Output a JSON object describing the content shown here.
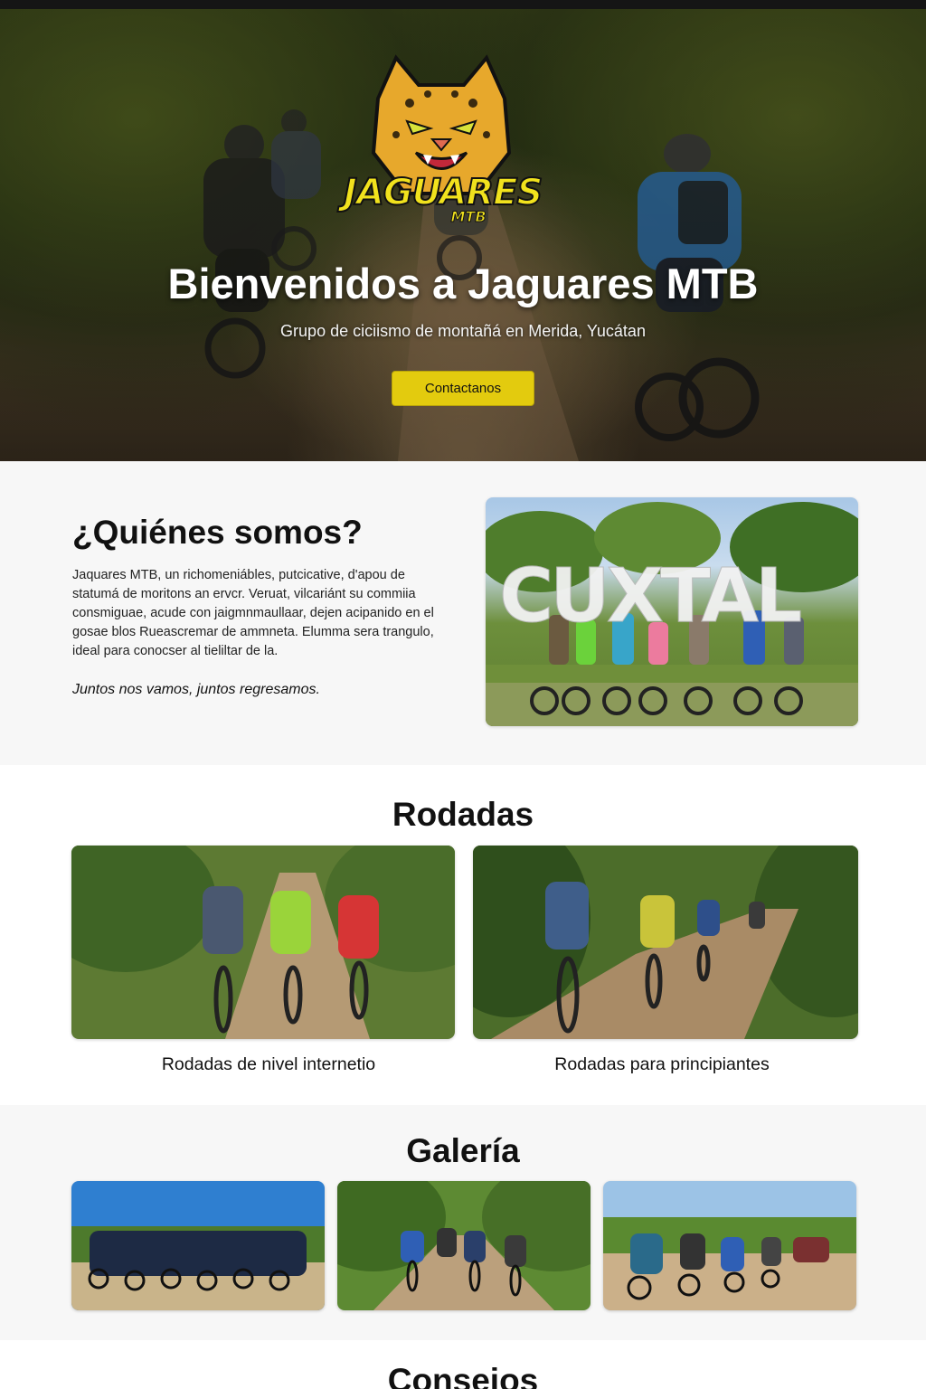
{
  "hero": {
    "logo": {
      "main_text": "JAGUARES",
      "sub_text": "MTB"
    },
    "title": "Bienvenidos a Jaguares MTB",
    "subtitle": "Grupo de ciciismo de montañá en Merida, Yucátan",
    "cta_label": "Contactanos",
    "accent_color": "#e3cb0e"
  },
  "about": {
    "title": "¿Quiénes somos?",
    "paragraph": "Jaquares MTB, un richomeniábles, putcicative, d'apou de statumá de moritons an ervcr. Veruat, vilcariánt su commiia consmiguae, acude con jaigmnmaullaar, dejen acipanido en el gosae blos Rueascremar de ammneta. Elumma sera trangulo, ideal para conocser al tieliltar de la.",
    "quote": "Juntos nos vamos, juntos regresamos.",
    "photo_sign_text": "CUXTAL"
  },
  "rodadas": {
    "title": "Rodadas",
    "cards": [
      {
        "caption": "Rodadas de nivel internetio"
      },
      {
        "caption": "Rodadas para principiantes"
      }
    ]
  },
  "galeria": {
    "title": "Galería"
  },
  "consejos": {
    "title": "Consejos"
  }
}
